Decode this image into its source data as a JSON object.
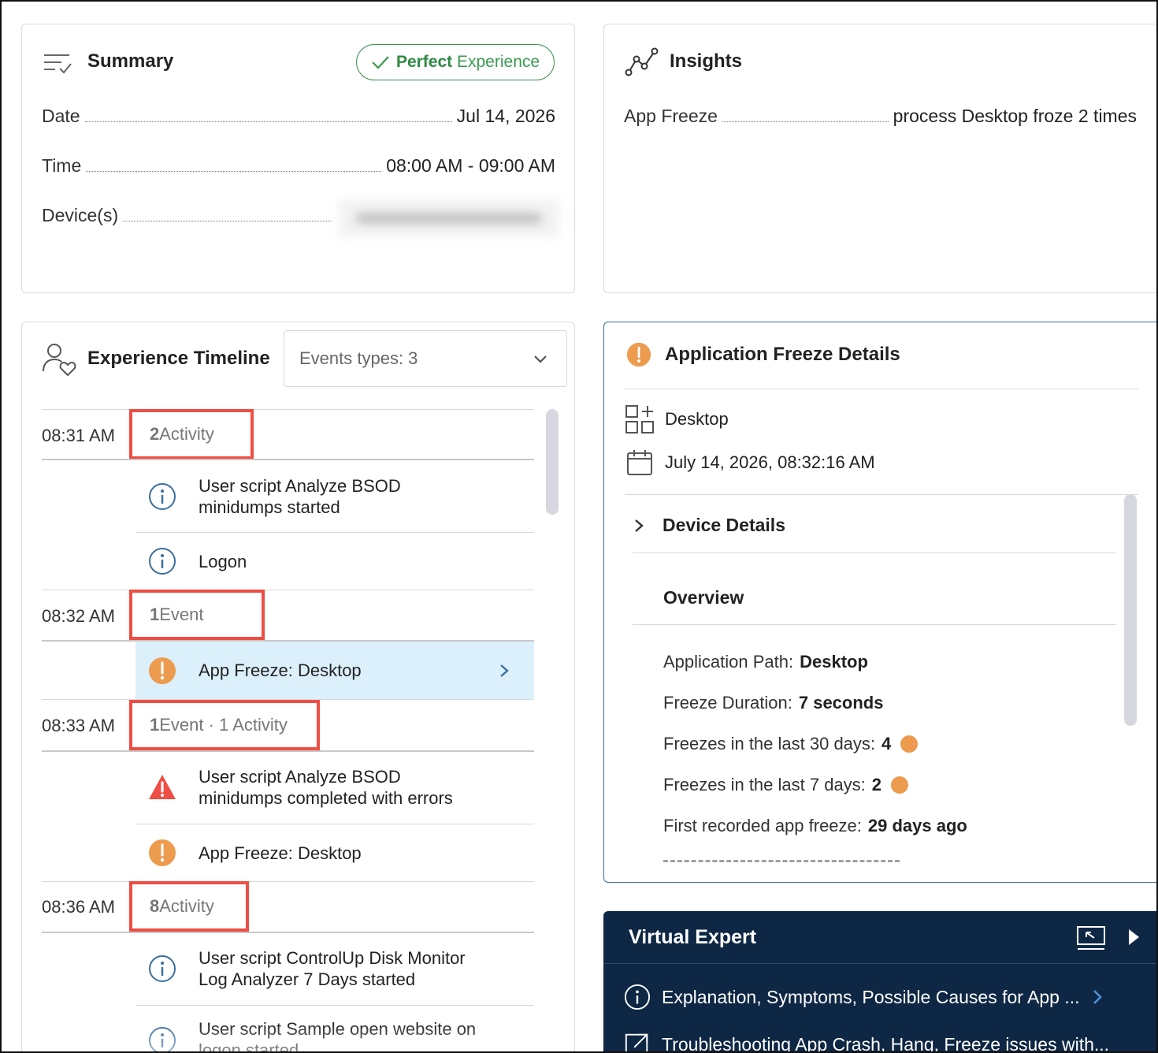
{
  "summary": {
    "title": "Summary",
    "badge_bold": "Perfect",
    "badge_rest": "Experience",
    "date_label": "Date",
    "date_value": "Jul 14, 2026",
    "time_label": "Time",
    "time_value": "08:00 AM - 09:00 AM",
    "devices_label": "Device(s)"
  },
  "insights": {
    "title": "Insights",
    "row_label": "App Freeze",
    "row_value": "process Desktop froze 2 times"
  },
  "timeline": {
    "title": "Experience Timeline",
    "filter_label": "Events types: 3",
    "groups": [
      {
        "time": "08:31 AM",
        "count_num": "2",
        "count_text": " Activity",
        "items": [
          {
            "icon": "info-icon",
            "text_1": "User script Analyze BSOD",
            "text_2": "minidumps started"
          },
          {
            "icon": "info-icon",
            "text_1": "Logon",
            "text_2": ""
          }
        ]
      },
      {
        "time": "08:32 AM",
        "count_num": "1",
        "count_text": " Event",
        "items": [
          {
            "icon": "warning-orange-icon",
            "text_1": "App Freeze: Desktop",
            "text_2": ""
          }
        ]
      },
      {
        "time": "08:33 AM",
        "count_num": "1",
        "count_text": " Event · 1 Activity",
        "items": [
          {
            "icon": "error-triangle-icon",
            "text_1": "User script Analyze BSOD",
            "text_2": "minidumps completed with errors"
          },
          {
            "icon": "warning-orange-icon",
            "text_1": "App Freeze: Desktop",
            "text_2": ""
          }
        ]
      },
      {
        "time": "08:36 AM",
        "count_num": "8",
        "count_text": " Activity",
        "items": [
          {
            "icon": "info-icon",
            "text_1": "User script ControlUp Disk Monitor",
            "text_2": "Log Analyzer 7 Days started"
          },
          {
            "icon": "info-icon",
            "text_1": "User script Sample open website on",
            "text_2": "logon started"
          }
        ]
      }
    ]
  },
  "freeze": {
    "title": "Application Freeze Details",
    "app_name": "Desktop",
    "timestamp": "July 14, 2026, 08:32:16 AM",
    "device_details": "Device Details",
    "overview": "Overview",
    "app_path_label": "Application Path:",
    "app_path_value": "Desktop",
    "duration_label": "Freeze Duration:",
    "duration_value": "7 seconds",
    "last30_label": "Freezes in the last 30 days:",
    "last30_value": "4",
    "last7_label": "Freezes in the last 7 days:",
    "last7_value": "2",
    "first_label": "First recorded app freeze:",
    "first_value": "29 days ago"
  },
  "virtual_expert": {
    "title": "Virtual Expert",
    "item_1": "Explanation, Symptoms, Possible Causes for App ...",
    "item_2": "Troubleshooting App Crash, Hang, Freeze issues with..."
  },
  "colors": {
    "accent_red": "#ef4e44",
    "warning_orange": "#ec9b4f",
    "success_green": "#2f8a45",
    "info_blue": "#3a6fa0",
    "navy": "#0e2744",
    "selected_row": "#dcf0fc"
  }
}
